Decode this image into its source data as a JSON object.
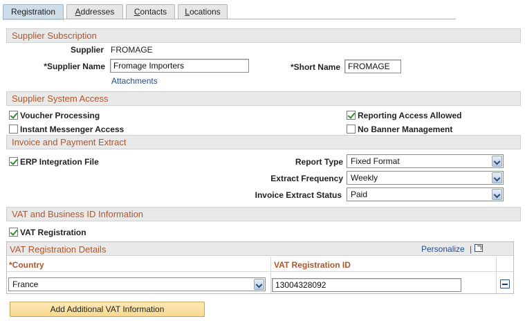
{
  "tabs": [
    {
      "label": "Registration",
      "active": true
    },
    {
      "label": "Addresses",
      "active": false,
      "underline_char": "A"
    },
    {
      "label": "Contacts",
      "active": false,
      "underline_char": "C"
    },
    {
      "label": "Locations",
      "active": false,
      "underline_char": "L"
    }
  ],
  "subscription": {
    "header": "Supplier Subscription",
    "supplier_label": "Supplier",
    "supplier_value": "FROMAGE",
    "supplier_name_label": "*Supplier Name",
    "supplier_name_value": "Fromage Importers",
    "short_name_label": "*Short Name",
    "short_name_value": "FROMAGE",
    "attachments_link": "Attachments"
  },
  "system_access": {
    "header": "Supplier System Access",
    "voucher_processing": {
      "label": "Voucher Processing",
      "checked": true
    },
    "reporting_access": {
      "label": "Reporting Access Allowed",
      "checked": true
    },
    "instant_messenger": {
      "label": "Instant Messenger Access",
      "checked": false
    },
    "no_banner": {
      "label": "No Banner Management",
      "checked": false
    }
  },
  "invoice_extract": {
    "header": "Invoice and Payment Extract",
    "erp_integration": {
      "label": "ERP Integration File",
      "checked": true
    },
    "report_type_label": "Report Type",
    "report_type_value": "Fixed Format",
    "extract_frequency_label": "Extract Frequency",
    "extract_frequency_value": "Weekly",
    "extract_status_label": "Invoice Extract Status",
    "extract_status_value": "Paid"
  },
  "vat": {
    "header": "VAT and Business ID Information",
    "vat_registration": {
      "label": "VAT Registration",
      "checked": true
    },
    "grid_title": "VAT Registration Details",
    "personalize": "Personalize",
    "pipe": "|",
    "col_country": "*Country",
    "col_vat_id": "VAT Registration ID",
    "rows": [
      {
        "country": "France",
        "vat_id": "13004328092"
      }
    ]
  },
  "add_button": "Add Additional VAT Information",
  "colors": {
    "section_text": "#b0552a",
    "link": "#1e4b8e",
    "button_bg": "#f9d98e"
  }
}
